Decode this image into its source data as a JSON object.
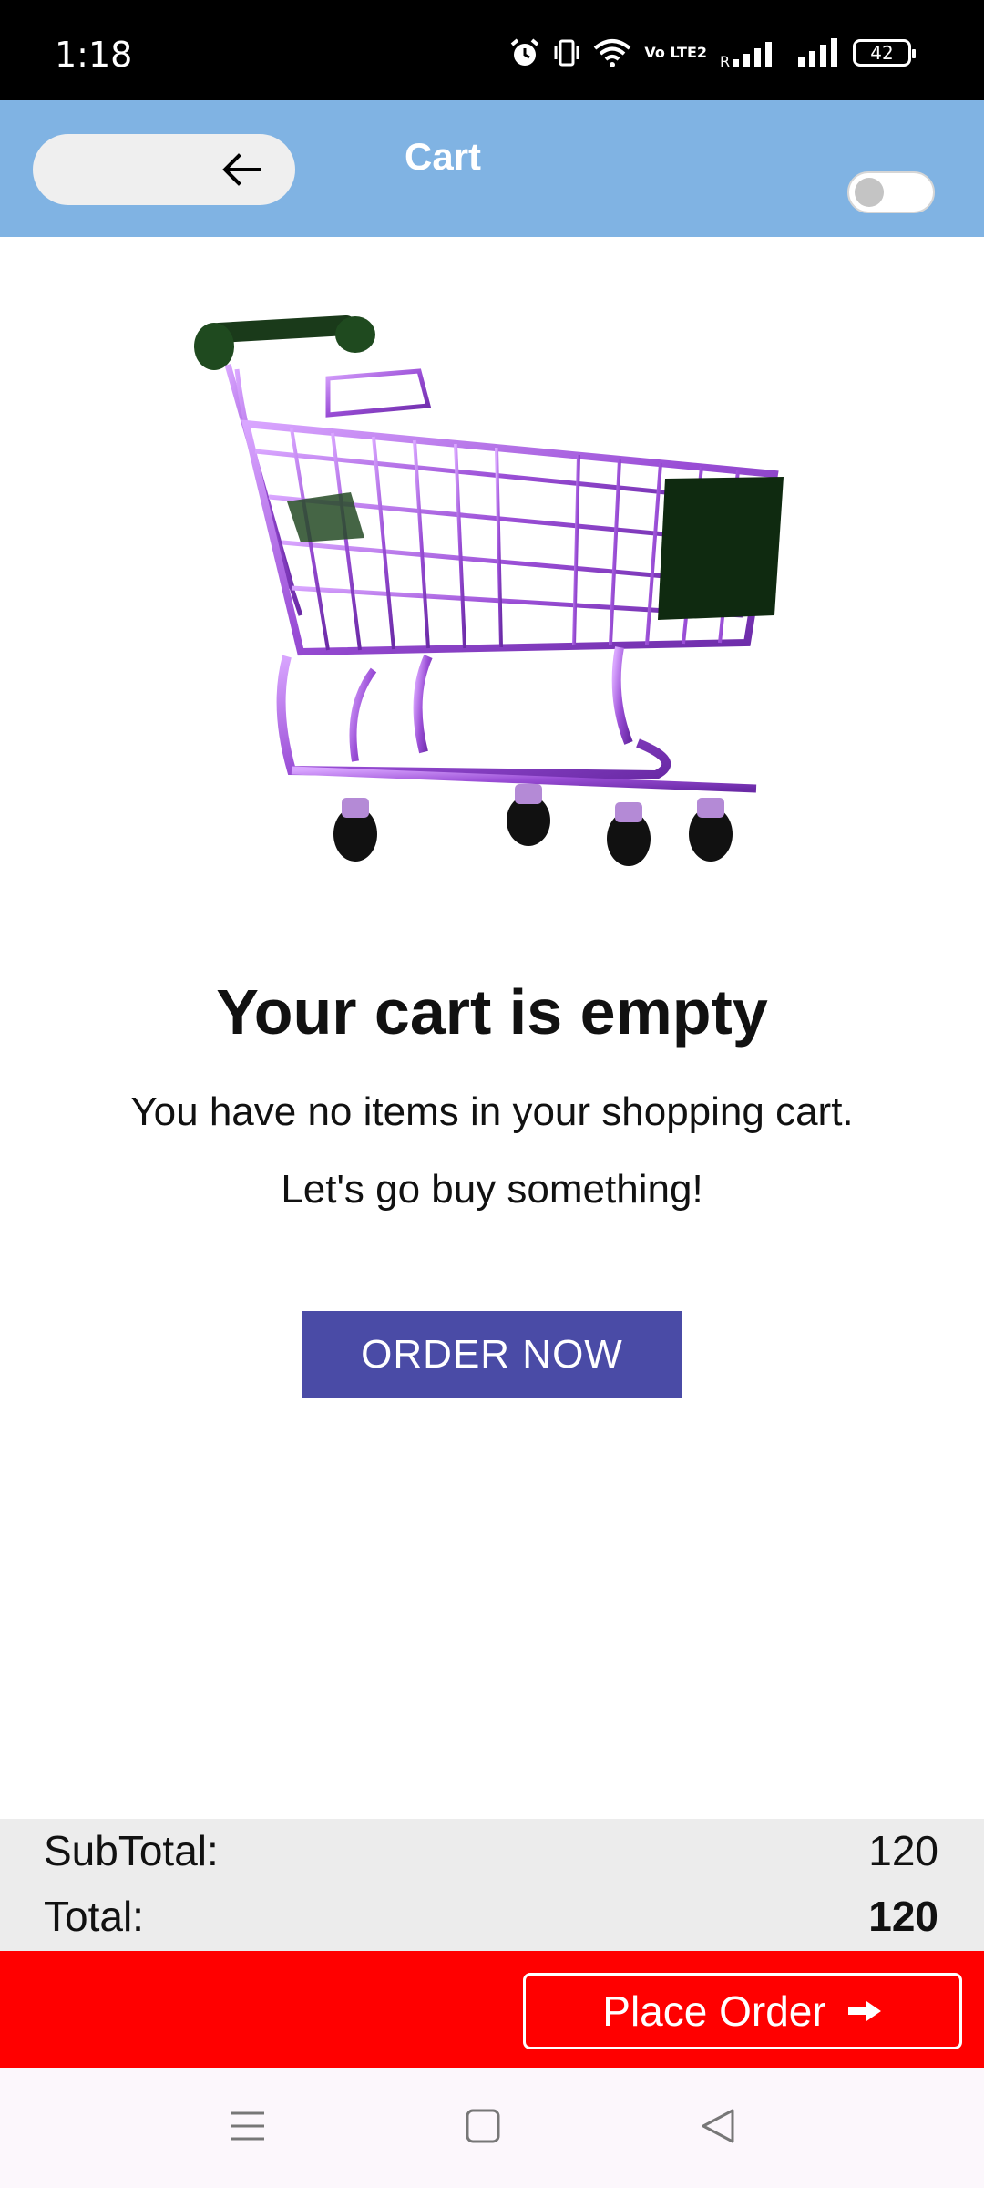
{
  "status_bar": {
    "time": "1:18",
    "network_label": "Vo LTE2",
    "roaming": "R",
    "battery": "42"
  },
  "app_bar": {
    "title": "Cart",
    "toggle_on": false
  },
  "empty_state": {
    "title": "Your cart is empty",
    "line1": "You have no items in your shopping cart.",
    "line2": "Let's go buy something!",
    "cta_label": "ORDER NOW"
  },
  "totals": {
    "subtotal_label": "SubTotal:",
    "subtotal_value": "120",
    "total_label": "Total:",
    "total_value": "120"
  },
  "order_bar": {
    "place_order_label": "Place Order"
  },
  "colors": {
    "app_bar": "#80b3e3",
    "order_now": "#4a4ba6",
    "order_bar": "#ff0000",
    "totals_bg": "#ececec"
  },
  "icons": [
    "alarm-icon",
    "vibrate-icon",
    "wifi-icon",
    "signal-icon",
    "battery-icon",
    "back-arrow-icon",
    "shopping-cart-illustration",
    "arrow-right-icon",
    "menu-nav-icon",
    "home-nav-icon",
    "back-nav-icon"
  ]
}
